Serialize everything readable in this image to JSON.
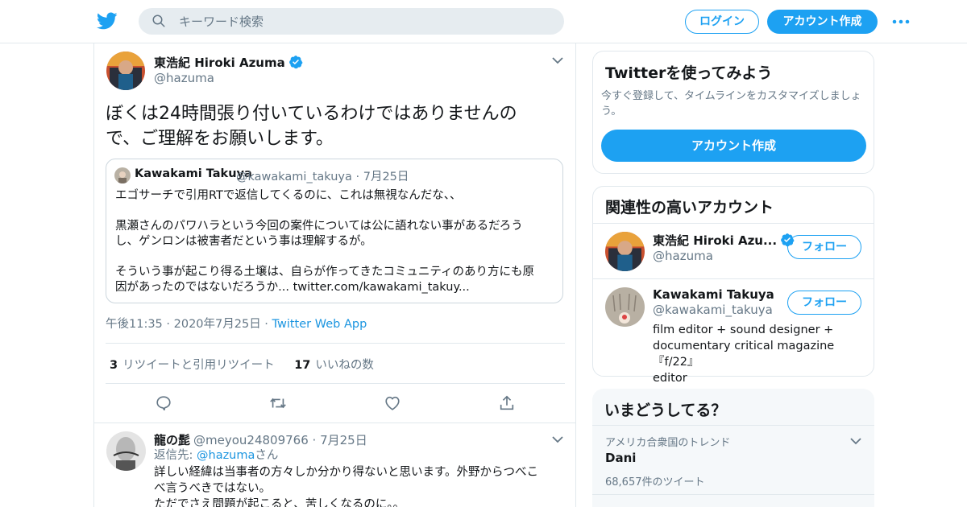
{
  "header": {
    "search_placeholder": "キーワード検索",
    "login_label": "ログイン",
    "signup_label": "アカウント作成"
  },
  "tweet": {
    "author_name": "東浩紀 Hiroki Azuma",
    "author_handle": "@hazuma",
    "text_line1": "ぼくは24時間張り付いているわけではありませんの",
    "text_line2": "で、ご理解をお願いします。",
    "quote": {
      "author_name": "Kawakami Takuya",
      "author_handle": "@kawakami_takuya",
      "date": "7月25日",
      "line1": "エゴサーチで引用RTで返信してくるのに、これは無視なんだな、、",
      "line2": "黒瀬さんのパワハラという今回の案件については公に語れない事があるだろう",
      "line3": "し、ゲンロンは被害者だという事は理解するが。",
      "line4": "そういう事が起こり得る土壌は、自らが作ってきたコミュニティのあり方にも原",
      "line5": "因があったのではないだろうか... twitter.com/kawakami_takuy..."
    },
    "time": "午後11:35",
    "date": "2020年7月25日",
    "source": "Twitter Web App",
    "retweet_count": "3",
    "retweet_label": "リツイートと引用リツイート",
    "like_count": "17",
    "like_label": "いいねの数"
  },
  "reply": {
    "author_name": "龍の髭",
    "author_handle": "@meyou24809766",
    "date": "7月25日",
    "replying_prefix": "返信先: ",
    "replying_handle": "@hazuma",
    "replying_suffix": "さん",
    "line1": "詳しい経緯は当事者の方々しか分かり得ないと思います。外野からつべこ",
    "line2": "べ言うべきではない。",
    "line3": "ただでさえ問題が起こると、苦しくなるのに。。"
  },
  "sidebar": {
    "signup_card": {
      "title": "Twitterを使ってみよう",
      "subtitle_line1": "今すぐ登録して、タイムラインをカスタマイズしましょ",
      "subtitle_line2": "う。",
      "button_label": "アカウント作成"
    },
    "related": {
      "title": "関連性の高いアカウント",
      "accounts": [
        {
          "name": "東浩紀 Hiroki Azu...",
          "handle": "@hazuma",
          "follow_label": "フォロー"
        },
        {
          "name": "Kawakami Takuya",
          "handle": "@kawakami_takuya",
          "follow_label": "フォロー",
          "bio_line1": "film editor + sound designer +",
          "bio_line2": "documentary critical magazine『f/22』",
          "bio_line3": "editor"
        }
      ]
    },
    "trends": {
      "title": "いまどうしてる？",
      "items": [
        {
          "context": "アメリカ合衆国のトレンド",
          "name": "Dani",
          "count": "68,657件のツイート"
        }
      ]
    }
  },
  "colors": {
    "accent": "#1da1f2",
    "text": "#14171a",
    "muted": "#657786",
    "border": "#e1e8ed",
    "verified": "#1da1f2"
  }
}
